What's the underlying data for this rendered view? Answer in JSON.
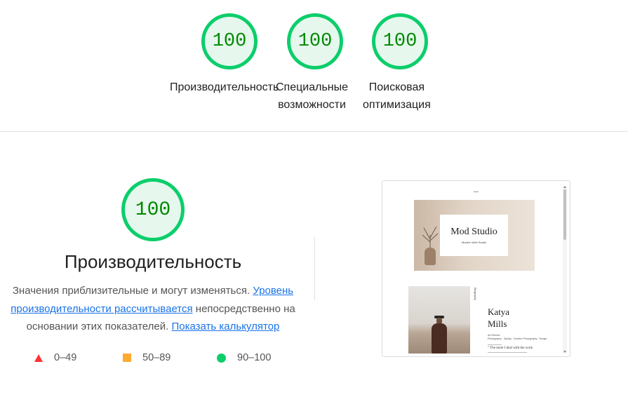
{
  "summary": {
    "gauges": [
      {
        "score": "100",
        "label_lines": [
          "Производительность"
        ]
      },
      {
        "score": "100",
        "label_lines": [
          "Специальные",
          "возможности"
        ]
      },
      {
        "score": "100",
        "label_lines": [
          "Поисковая",
          "оптимизация"
        ]
      }
    ]
  },
  "category": {
    "score": "100",
    "title": "Производительность",
    "desc_text_1": "Значения приблизительные и могут изменяться. ",
    "desc_link_1": "Уровень производительности рассчитывается",
    "desc_text_2": " непосредственно на основании этих показателей. ",
    "desc_link_2": "Показать калькулятор"
  },
  "legend": {
    "fail": "0–49",
    "average": "50–89",
    "pass": "90–100"
  },
  "preview": {
    "hero_title": "Mod Studio",
    "hero_subtitle": "Modern Web Studio",
    "side_label": "Biography",
    "name_line1": "Katya",
    "name_line2": "Mills",
    "meta_1": "Art Director",
    "meta_2": "Photography · Styling · Creative Photography · Design",
    "quote": "\" The more I deal with the work"
  },
  "colors": {
    "pass": "#0cce6b",
    "pass_text": "#008800",
    "pass_fill": "#e6f8ee",
    "average": "#ffaa33",
    "fail": "#ff3333",
    "link": "#1a73e8"
  }
}
